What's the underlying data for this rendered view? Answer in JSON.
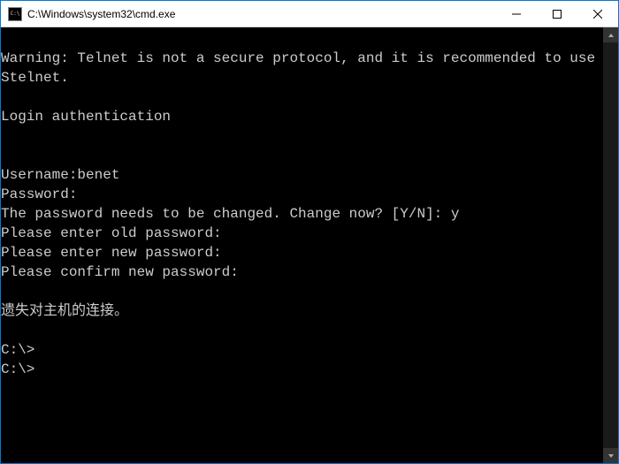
{
  "window": {
    "title": "C:\\Windows\\system32\\cmd.exe"
  },
  "terminal": {
    "lines": [
      "",
      "Warning: Telnet is not a secure protocol, and it is recommended to use Stelnet.",
      "",
      "Login authentication",
      "",
      "",
      "Username:benet",
      "Password:",
      "The password needs to be changed. Change now? [Y/N]: y",
      "Please enter old password:",
      "Please enter new password:",
      "Please confirm new password:",
      "",
      "遗失对主机的连接。",
      "",
      "C:\\>",
      "C:\\>"
    ]
  }
}
